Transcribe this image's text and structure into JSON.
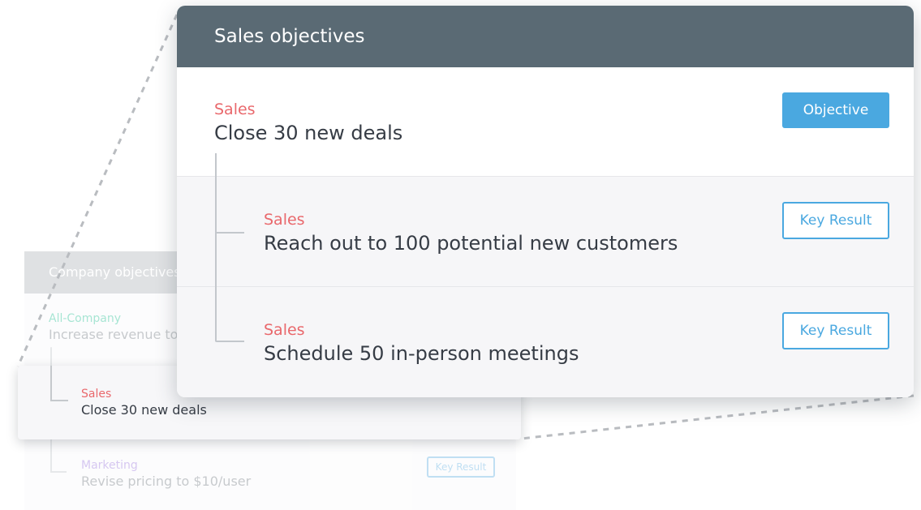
{
  "background_card": {
    "header": "Company objectives",
    "top_item": {
      "dept": "All-Company",
      "title": "Increase revenue to"
    },
    "bottom_item": {
      "dept": "Marketing",
      "title": "Revise pricing to $10/user",
      "button": "Key Result"
    }
  },
  "highlighted_row": {
    "dept": "Sales",
    "title": "Close 30 new deals"
  },
  "card": {
    "header": "Sales objectives",
    "objective": {
      "dept": "Sales",
      "title": "Close 30 new deals",
      "button": "Objective"
    },
    "key_results": [
      {
        "dept": "Sales",
        "title": "Reach out to 100 potential new customers",
        "button": "Key Result"
      },
      {
        "dept": "Sales",
        "title": "Schedule 50 in-person meetings",
        "button": "Key Result"
      }
    ]
  },
  "colors": {
    "header": "#5a6a74",
    "dept_sales": "#e9686c",
    "dept_all_company": "#5fd0b0",
    "dept_marketing": "#b59be6",
    "accent_blue": "#4aa8e0"
  }
}
